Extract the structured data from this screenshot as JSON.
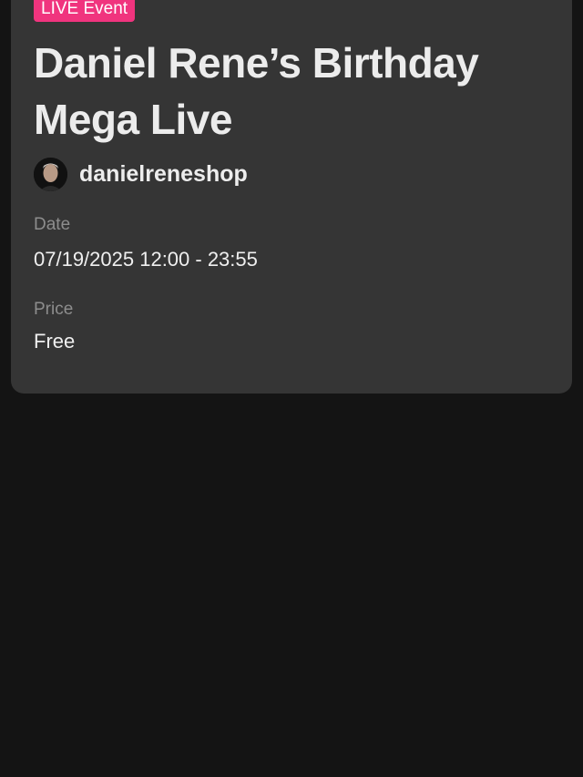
{
  "event": {
    "badge": "LIVE Event",
    "title": "Daniel Rene’s Birthday Mega Live",
    "host": {
      "username": "danielreneshop",
      "avatar_icon": "user-avatar-photo"
    },
    "date_label": "Date",
    "date_value": "07/19/2025 12:00 - 23:55",
    "price_label": "Price",
    "price_value": "Free"
  },
  "colors": {
    "badge": "#f0347e",
    "card": "#353535",
    "background": "#141414",
    "label": "#8d8d8d"
  }
}
